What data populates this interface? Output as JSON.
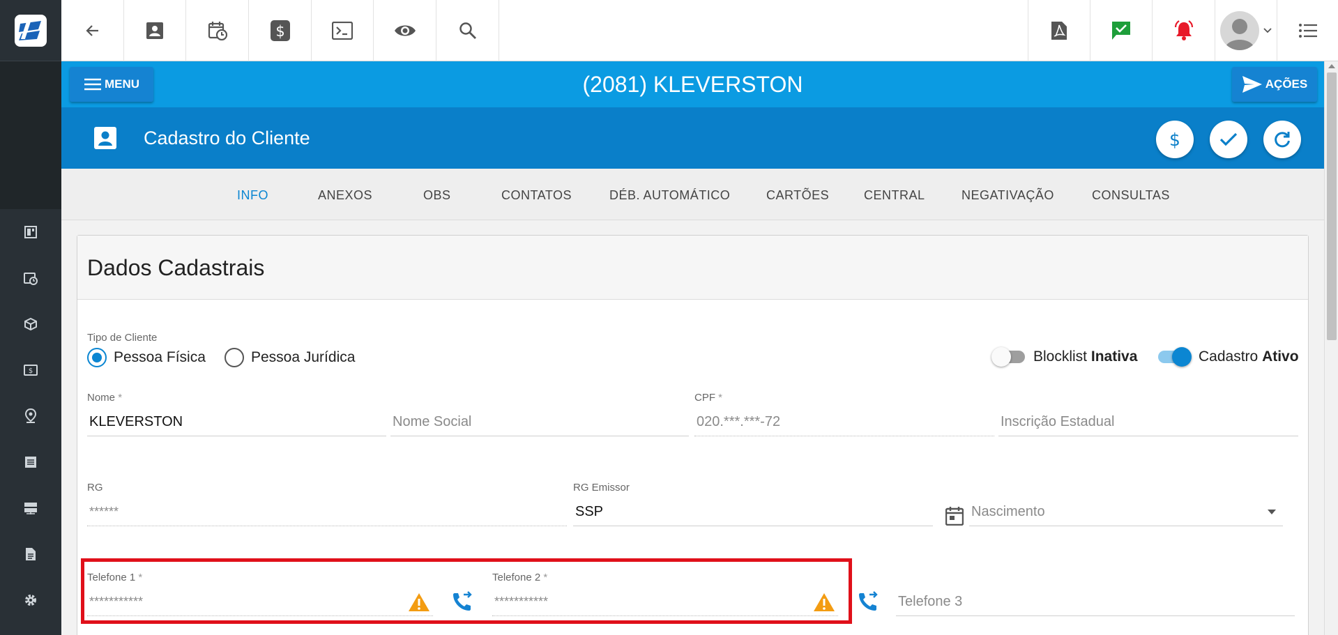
{
  "page": {
    "title": "(2081) KLEVERSTON",
    "menu_label": "MENU",
    "acoes_label": "AÇÕES",
    "section_title": "Cadastro do Cliente"
  },
  "tabs": [
    "INFO",
    "ANEXOS",
    "OBS",
    "CONTATOS",
    "DÉB. AUTOMÁTICO",
    "CARTÕES",
    "CENTRAL",
    "NEGATIVAÇÃO",
    "CONSULTAS"
  ],
  "active_tab": "INFO",
  "card": {
    "title": "Dados Cadastrais",
    "tipo_label": "Tipo de Cliente",
    "radio_fisica": "Pessoa Física",
    "radio_juridica": "Pessoa Jurídica",
    "blocklist_label": "Blocklist",
    "blocklist_state": "Inativa",
    "cadastro_label": "Cadastro",
    "cadastro_state": "Ativo"
  },
  "fields": {
    "nome_label": "Nome",
    "nome_value": "KLEVERSTON",
    "nome_social_placeholder": "Nome Social",
    "cpf_label": "CPF",
    "cpf_value": "020.***.***-72",
    "inscricao_placeholder": "Inscrição Estadual",
    "rg_label": "RG",
    "rg_value": "******",
    "rg_emissor_label": "RG Emissor",
    "rg_emissor_value": "SSP",
    "nascimento_placeholder": "Nascimento",
    "tel1_label": "Telefone 1",
    "tel1_value": "***********",
    "tel2_label": "Telefone 2",
    "tel2_value": "***********",
    "tel3_placeholder": "Telefone 3",
    "required_mark": "*"
  },
  "colors": {
    "title_bar": "#0b9be2",
    "sub_bar": "#0a7fc9",
    "accent": "#0b86d2",
    "highlight": "#e0101a",
    "warning": "#f39c12",
    "sidebar": "#293036"
  },
  "icons": {
    "top": [
      "back-arrow-icon",
      "contact-card-icon",
      "calendar-clock-icon",
      "dollar-icon",
      "terminal-icon",
      "eye-icon",
      "search-icon"
    ],
    "top_right": [
      "pdf-icon",
      "chat-check-icon",
      "alarm-bell-icon",
      "avatar",
      "list-icon"
    ],
    "sidebar": [
      "dashboard-icon",
      "calendar-clock-icon",
      "box-icon",
      "money-icon",
      "location-icon",
      "list-box-icon",
      "server-icon",
      "document-icon",
      "gear-icon"
    ]
  }
}
